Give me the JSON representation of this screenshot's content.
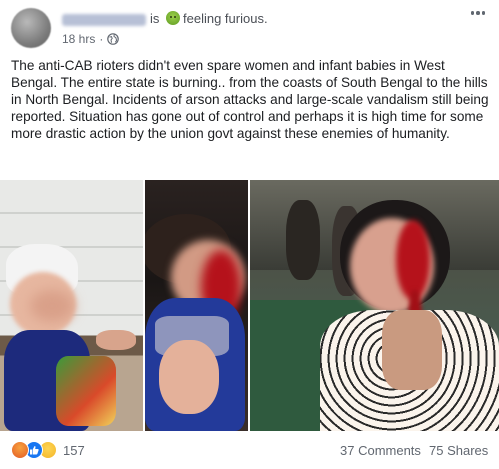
{
  "post": {
    "author_name": "•••••• •••••",
    "is_word": "is",
    "feeling_text": "feeling furious.",
    "feeling_icon": "angry-green-face-icon",
    "timestamp": "18 hrs",
    "separator": "·",
    "privacy_icon": "globe-icon",
    "text": "The anti-CAB rioters didn't even spare women and infant babies in West Bengal. The entire state is burning.. from the coasts of South Bengal to the hills in North Bengal. Incidents of arson attacks and large-scale vandalism still being reported. Situation has gone out of control and perhaps it is high time for some more drastic action by the union govt against these enemies of humanity."
  },
  "photos": [
    {
      "icon": "photo-injured-child-bandaged-head"
    },
    {
      "icon": "photo-injured-child-bleeding"
    },
    {
      "icon": "photo-injured-woman-bleeding"
    }
  ],
  "reactions": {
    "icons": [
      "angry-reaction-icon",
      "like-reaction-icon",
      "sad-reaction-icon"
    ],
    "count": "157"
  },
  "stats": {
    "comments": "37 Comments",
    "shares": "75 Shares"
  },
  "colors": {
    "text": "#1c1e21",
    "secondary": "#616770",
    "like_blue": "#1877f2",
    "blood": "#b5121b"
  }
}
